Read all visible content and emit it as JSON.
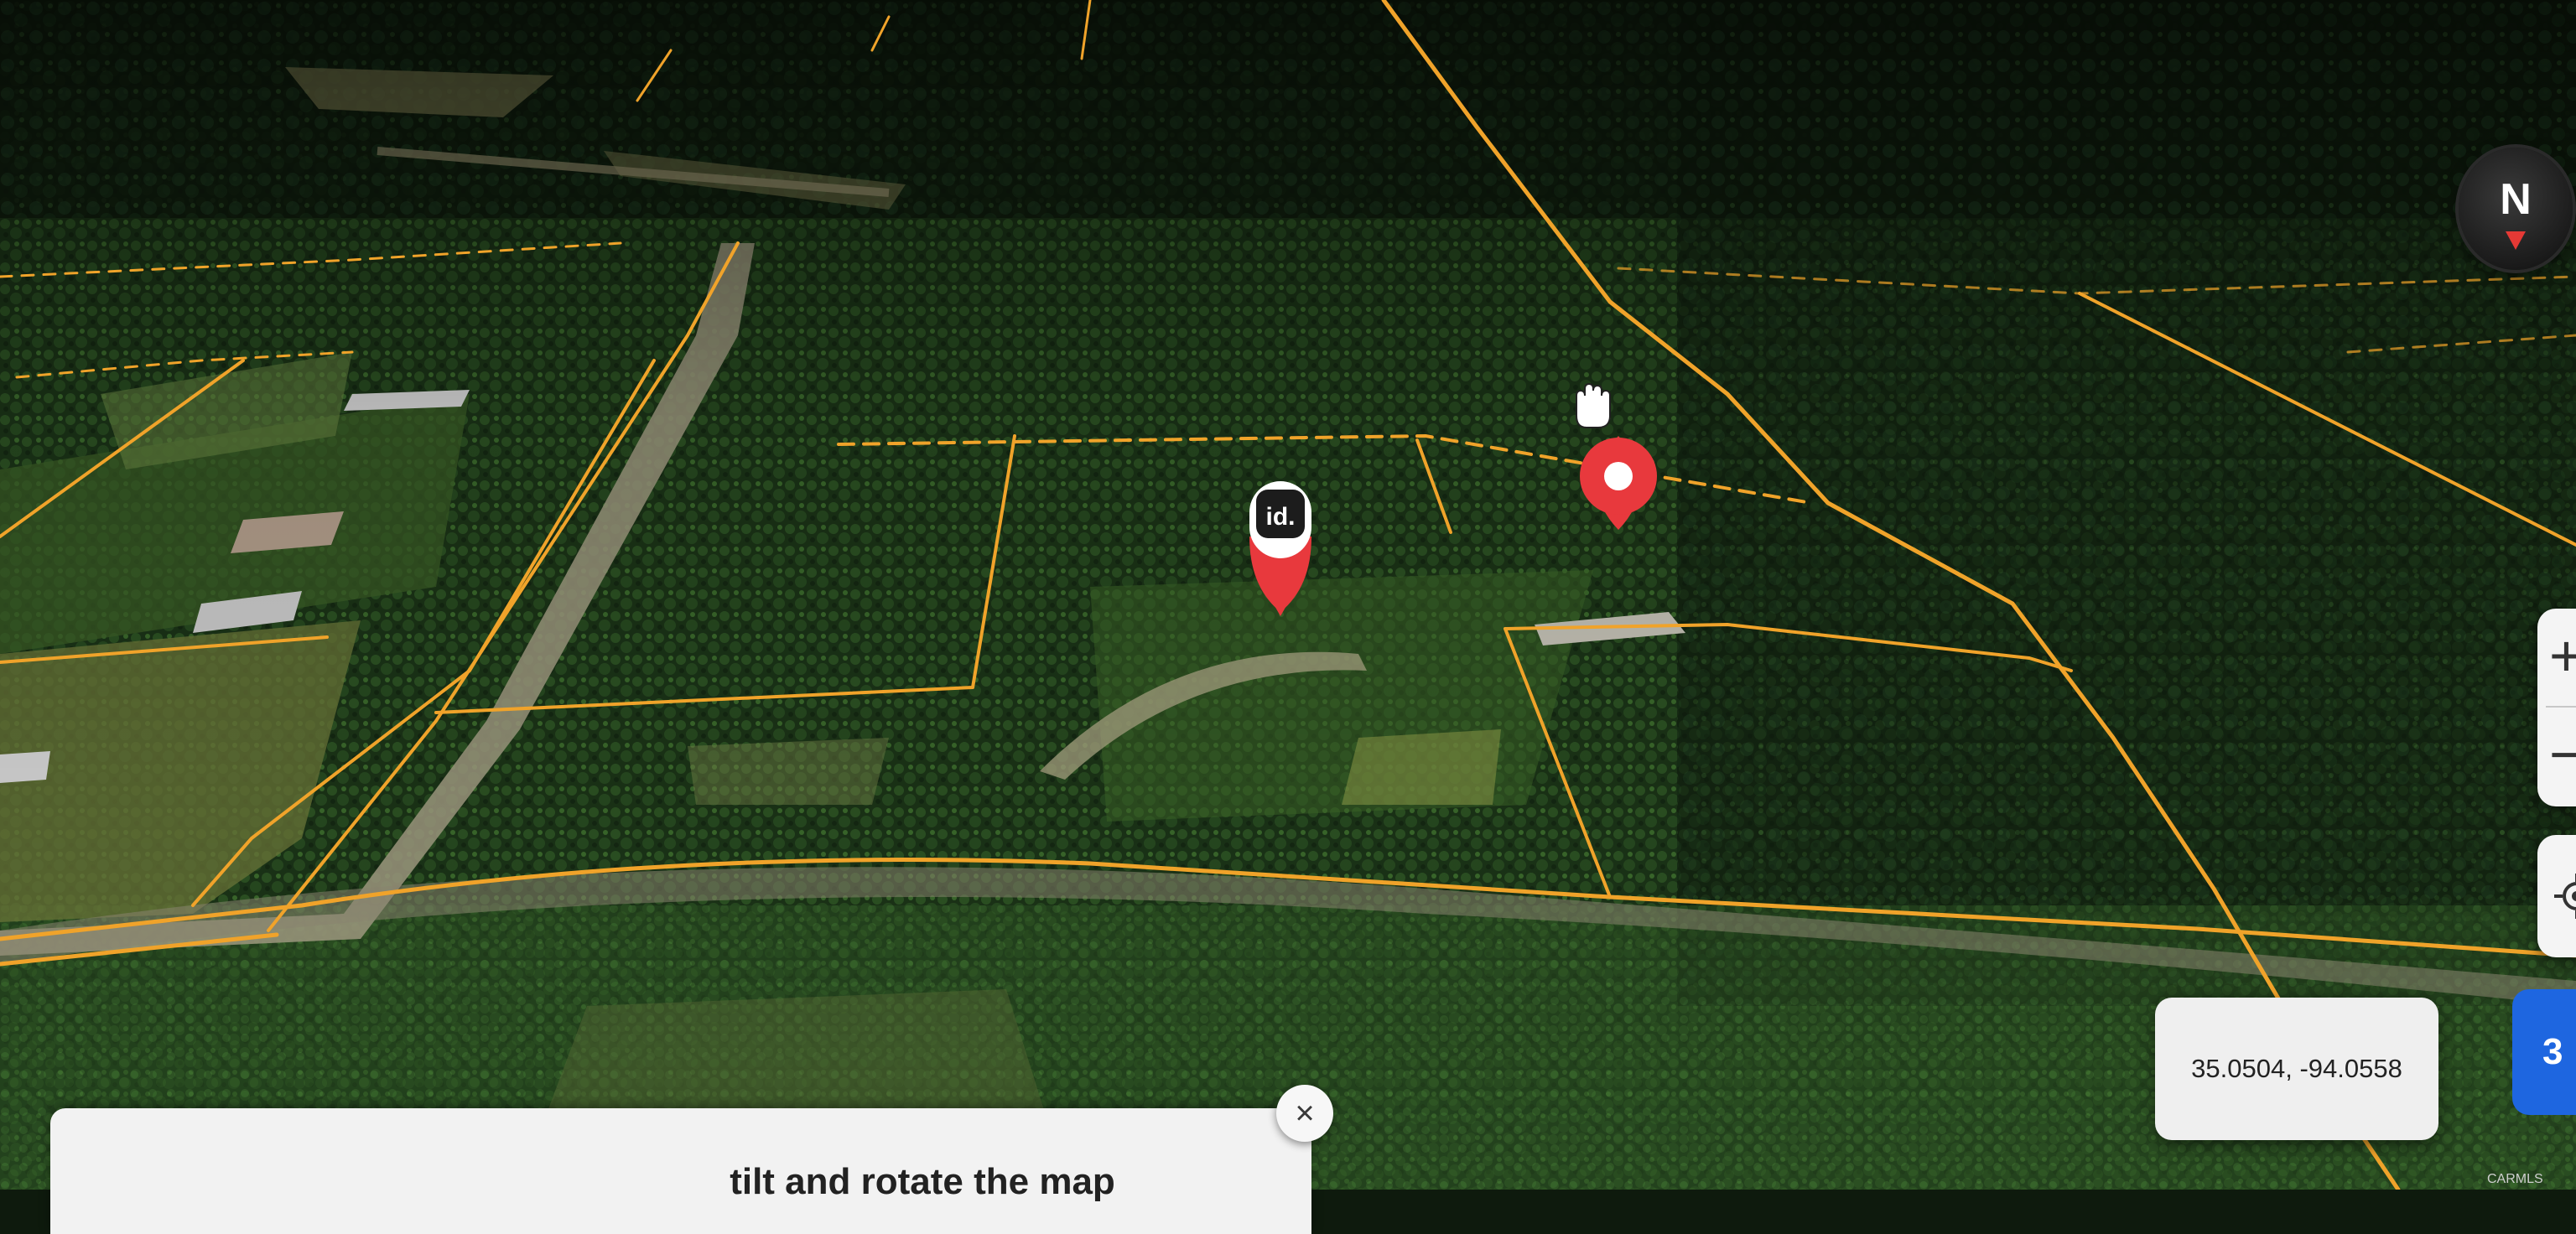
{
  "map": {
    "view": "satellite, tilted 3D",
    "imagery_colors": {
      "forest_dark": "#0f1d0e",
      "forest_mid": "#21401c",
      "forest_light": "#3d6a2b",
      "clearing": "#8a8650",
      "dirt_road": "#9b9779"
    },
    "parcel_line_color": "#f0a32a"
  },
  "markers": {
    "listing_logo": "id.",
    "location_pin_color": "#e8393d"
  },
  "compass": {
    "label": "N",
    "icon": "compass-icon"
  },
  "zoom": {
    "in_label": "+",
    "out_label": "−"
  },
  "locate": {
    "icon": "crosshair-icon"
  },
  "coordinates": {
    "text": "35.0504, -94.0558"
  },
  "blue_button": {
    "label": "3"
  },
  "hint": {
    "text": "tilt and rotate the map"
  },
  "close": {
    "label": "×"
  },
  "cursor": {
    "icon": "hand-cursor-icon"
  },
  "watermark": {
    "text": "CARMLS"
  }
}
